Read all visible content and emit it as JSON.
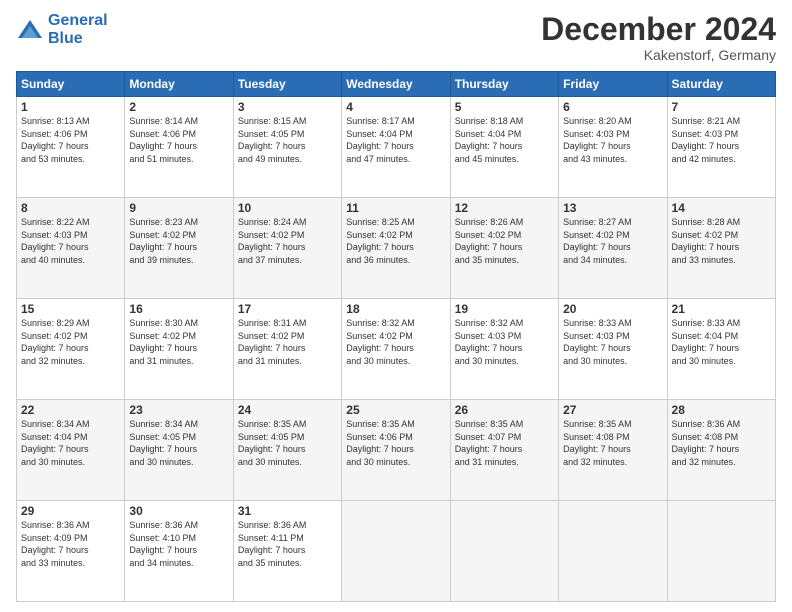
{
  "header": {
    "logo_line1": "General",
    "logo_line2": "Blue",
    "month": "December 2024",
    "location": "Kakenstorf, Germany"
  },
  "weekdays": [
    "Sunday",
    "Monday",
    "Tuesday",
    "Wednesday",
    "Thursday",
    "Friday",
    "Saturday"
  ],
  "weeks": [
    [
      {
        "day": "1",
        "info": "Sunrise: 8:13 AM\nSunset: 4:06 PM\nDaylight: 7 hours\nand 53 minutes."
      },
      {
        "day": "2",
        "info": "Sunrise: 8:14 AM\nSunset: 4:06 PM\nDaylight: 7 hours\nand 51 minutes."
      },
      {
        "day": "3",
        "info": "Sunrise: 8:15 AM\nSunset: 4:05 PM\nDaylight: 7 hours\nand 49 minutes."
      },
      {
        "day": "4",
        "info": "Sunrise: 8:17 AM\nSunset: 4:04 PM\nDaylight: 7 hours\nand 47 minutes."
      },
      {
        "day": "5",
        "info": "Sunrise: 8:18 AM\nSunset: 4:04 PM\nDaylight: 7 hours\nand 45 minutes."
      },
      {
        "day": "6",
        "info": "Sunrise: 8:20 AM\nSunset: 4:03 PM\nDaylight: 7 hours\nand 43 minutes."
      },
      {
        "day": "7",
        "info": "Sunrise: 8:21 AM\nSunset: 4:03 PM\nDaylight: 7 hours\nand 42 minutes."
      }
    ],
    [
      {
        "day": "8",
        "info": "Sunrise: 8:22 AM\nSunset: 4:03 PM\nDaylight: 7 hours\nand 40 minutes."
      },
      {
        "day": "9",
        "info": "Sunrise: 8:23 AM\nSunset: 4:02 PM\nDaylight: 7 hours\nand 39 minutes."
      },
      {
        "day": "10",
        "info": "Sunrise: 8:24 AM\nSunset: 4:02 PM\nDaylight: 7 hours\nand 37 minutes."
      },
      {
        "day": "11",
        "info": "Sunrise: 8:25 AM\nSunset: 4:02 PM\nDaylight: 7 hours\nand 36 minutes."
      },
      {
        "day": "12",
        "info": "Sunrise: 8:26 AM\nSunset: 4:02 PM\nDaylight: 7 hours\nand 35 minutes."
      },
      {
        "day": "13",
        "info": "Sunrise: 8:27 AM\nSunset: 4:02 PM\nDaylight: 7 hours\nand 34 minutes."
      },
      {
        "day": "14",
        "info": "Sunrise: 8:28 AM\nSunset: 4:02 PM\nDaylight: 7 hours\nand 33 minutes."
      }
    ],
    [
      {
        "day": "15",
        "info": "Sunrise: 8:29 AM\nSunset: 4:02 PM\nDaylight: 7 hours\nand 32 minutes."
      },
      {
        "day": "16",
        "info": "Sunrise: 8:30 AM\nSunset: 4:02 PM\nDaylight: 7 hours\nand 31 minutes."
      },
      {
        "day": "17",
        "info": "Sunrise: 8:31 AM\nSunset: 4:02 PM\nDaylight: 7 hours\nand 31 minutes."
      },
      {
        "day": "18",
        "info": "Sunrise: 8:32 AM\nSunset: 4:02 PM\nDaylight: 7 hours\nand 30 minutes."
      },
      {
        "day": "19",
        "info": "Sunrise: 8:32 AM\nSunset: 4:03 PM\nDaylight: 7 hours\nand 30 minutes."
      },
      {
        "day": "20",
        "info": "Sunrise: 8:33 AM\nSunset: 4:03 PM\nDaylight: 7 hours\nand 30 minutes."
      },
      {
        "day": "21",
        "info": "Sunrise: 8:33 AM\nSunset: 4:04 PM\nDaylight: 7 hours\nand 30 minutes."
      }
    ],
    [
      {
        "day": "22",
        "info": "Sunrise: 8:34 AM\nSunset: 4:04 PM\nDaylight: 7 hours\nand 30 minutes."
      },
      {
        "day": "23",
        "info": "Sunrise: 8:34 AM\nSunset: 4:05 PM\nDaylight: 7 hours\nand 30 minutes."
      },
      {
        "day": "24",
        "info": "Sunrise: 8:35 AM\nSunset: 4:05 PM\nDaylight: 7 hours\nand 30 minutes."
      },
      {
        "day": "25",
        "info": "Sunrise: 8:35 AM\nSunset: 4:06 PM\nDaylight: 7 hours\nand 30 minutes."
      },
      {
        "day": "26",
        "info": "Sunrise: 8:35 AM\nSunset: 4:07 PM\nDaylight: 7 hours\nand 31 minutes."
      },
      {
        "day": "27",
        "info": "Sunrise: 8:35 AM\nSunset: 4:08 PM\nDaylight: 7 hours\nand 32 minutes."
      },
      {
        "day": "28",
        "info": "Sunrise: 8:36 AM\nSunset: 4:08 PM\nDaylight: 7 hours\nand 32 minutes."
      }
    ],
    [
      {
        "day": "29",
        "info": "Sunrise: 8:36 AM\nSunset: 4:09 PM\nDaylight: 7 hours\nand 33 minutes."
      },
      {
        "day": "30",
        "info": "Sunrise: 8:36 AM\nSunset: 4:10 PM\nDaylight: 7 hours\nand 34 minutes."
      },
      {
        "day": "31",
        "info": "Sunrise: 8:36 AM\nSunset: 4:11 PM\nDaylight: 7 hours\nand 35 minutes."
      },
      null,
      null,
      null,
      null
    ]
  ]
}
